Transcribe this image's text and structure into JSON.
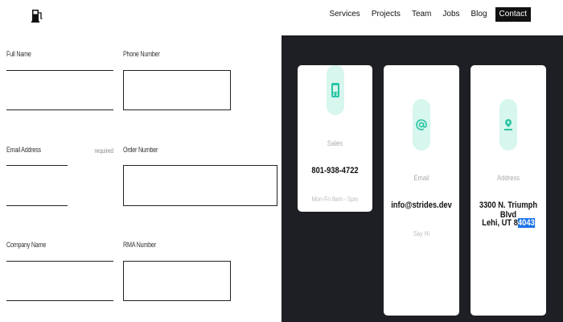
{
  "nav": {
    "items": [
      "Services",
      "Projects",
      "Team",
      "Jobs",
      "Blog"
    ],
    "cta": "Contact"
  },
  "form": {
    "full_name_label": "Full Name",
    "phone_label": "Phone Number",
    "email_label": "Email Address",
    "email_required": "required",
    "order_label": "Order Number",
    "company_label": "Company Name",
    "rma_label": "RMA Number"
  },
  "contact_cards": {
    "sales": {
      "label": "Sales",
      "value": "801-938-4722",
      "note": "Mon-Fri 8am - 5pm",
      "icon": "phone-icon"
    },
    "email": {
      "label": "Email",
      "value": "info@strides.dev",
      "note": "Say Hi",
      "icon": "at-icon"
    },
    "address": {
      "label": "Address",
      "line1": "3300 N. Triumph Blvd",
      "line2_prefix": "Lehi, UT 8",
      "line2_selected": "4043",
      "icon": "map-pin-icon"
    }
  },
  "colors": {
    "panel_bg": "#1e1f24",
    "icon_bubble": "#d6f6ee",
    "icon_accent": "#2bc4a3",
    "selection": "#1a73e8"
  }
}
